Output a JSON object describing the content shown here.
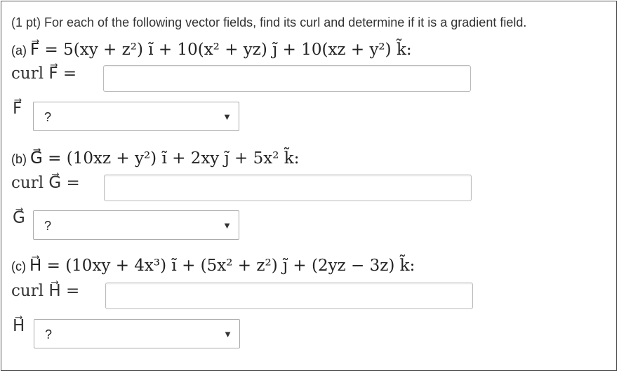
{
  "intro": "(1 pt) For each of the following vector fields, find its curl and determine if it is a gradient field.",
  "parts": [
    {
      "label": "(a)",
      "field": "F⃗ = 5(xy + z²) ĩ + 10(x² + yz) j̃ + 10(xz + y²) k̃:",
      "curl_label": "curl F⃗ =",
      "curl_value": "",
      "name": "F⃗",
      "select_value": "?"
    },
    {
      "label": "(b)",
      "field": "G⃗ = (10xz + y²) ĩ + 2xy j̃ + 5x² k̃:",
      "curl_label": "curl G⃗ =",
      "curl_value": "",
      "name": "G⃗",
      "select_value": "?"
    },
    {
      "label": "(c)",
      "field": "H⃗ = (10xy + 4x³) ĩ + (5x² + z²) j̃ + (2yz − 3z) k̃:",
      "curl_label": "curl H⃗ =",
      "curl_value": "",
      "name": "H⃗",
      "select_value": "?"
    }
  ],
  "icons": {
    "dropdown": "triangle-down-icon"
  }
}
